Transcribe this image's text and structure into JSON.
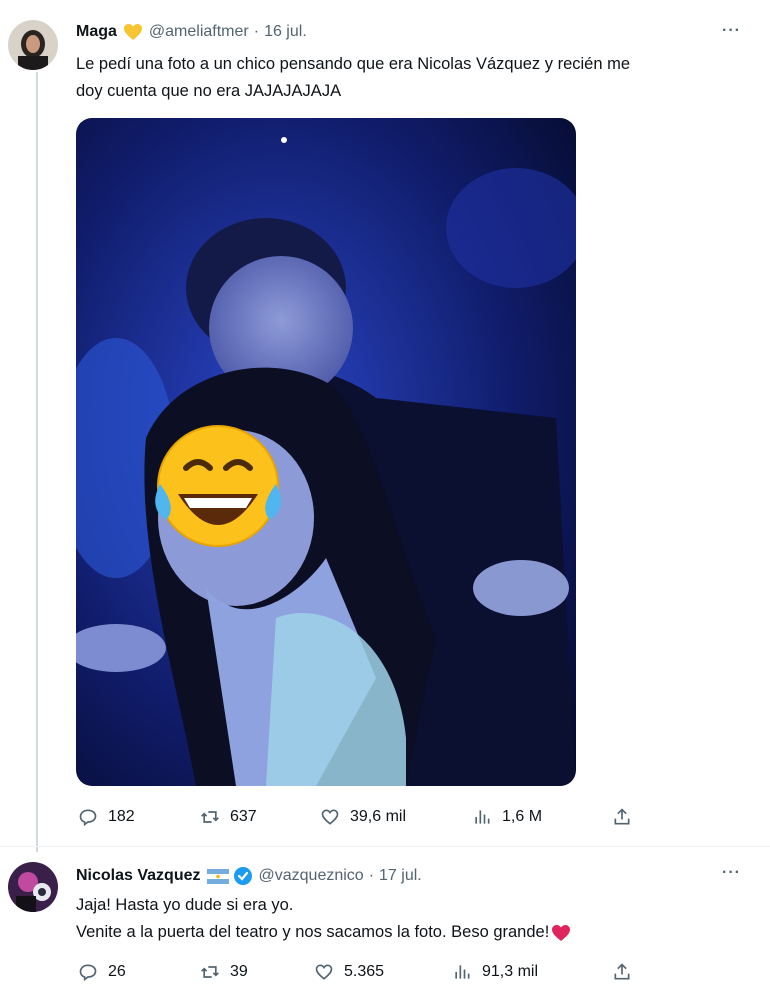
{
  "tweets": [
    {
      "name": "Maga",
      "badge": "yellow-heart-emoji",
      "handle": "@ameliaftmer",
      "date": "16 jul.",
      "lines": [
        "Le pedí una foto a un chico pensando que era Nicolas Vázquez y recién me",
        "doy cuenta que no era JAJAJAJAJA"
      ],
      "stats": {
        "replies": "182",
        "retweets": "637",
        "likes": "39,6 mil",
        "views": "1,6 M"
      }
    },
    {
      "name": "Nicolas Vazquez",
      "badge": "argentina-flag-emoji",
      "handle": "@vazqueznico",
      "date": "17 jul.",
      "lines": [
        "Jaja! Hasta yo dude si era yo.",
        "Venite a la puerta del teatro y nos sacamos la foto. Beso grande!"
      ],
      "stats": {
        "replies": "26",
        "retweets": "39",
        "likes": "5.365",
        "views": "91,3 mil"
      }
    }
  ],
  "separator": "·",
  "more": "···",
  "colors": {
    "text": "#0f1419",
    "secondary": "#536471",
    "verified": "#1d9bf0",
    "heart": "#e0245e"
  }
}
